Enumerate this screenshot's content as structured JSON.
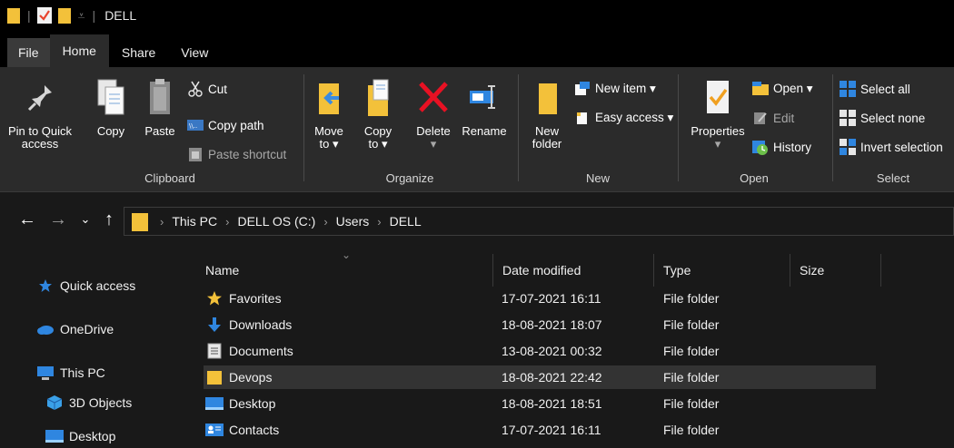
{
  "window": {
    "title": "DELL"
  },
  "colors": {
    "accent_folder": "#f3c13a",
    "selection": "#333333",
    "blue": "#1e90ff"
  },
  "tabs": [
    {
      "label": "File"
    },
    {
      "label": "Home"
    },
    {
      "label": "Share"
    },
    {
      "label": "View"
    }
  ],
  "ribbon": {
    "clipboard": {
      "group_label": "Clipboard",
      "pin_label_1": "Pin to Quick",
      "pin_label_2": "access",
      "copy_label": "Copy",
      "paste_label": "Paste",
      "cut_label": "Cut",
      "copy_path_label": "Copy path",
      "paste_shortcut_label": "Paste shortcut"
    },
    "organize": {
      "group_label": "Organize",
      "move_to_1": "Move",
      "move_to_2": "to ▾",
      "copy_to_1": "Copy",
      "copy_to_2": "to ▾",
      "delete_label": "Delete",
      "rename_label": "Rename"
    },
    "new": {
      "group_label": "New",
      "new_folder_1": "New",
      "new_folder_2": "folder",
      "new_item_label": "New item ▾",
      "easy_access_label": "Easy access ▾"
    },
    "open": {
      "group_label": "Open",
      "properties_label": "Properties",
      "open_label": "Open ▾",
      "edit_label": "Edit",
      "history_label": "History"
    },
    "select": {
      "group_label": "Select",
      "select_all_label": "Select all",
      "select_none_label": "Select none",
      "invert_selection_label": "Invert selection"
    }
  },
  "breadcrumb": [
    "This PC",
    "DELL OS (C:)",
    "Users",
    "DELL"
  ],
  "navpane": {
    "items": [
      {
        "label": "Quick access",
        "icon": "star-icon"
      },
      {
        "label": "OneDrive",
        "icon": "cloud-icon"
      },
      {
        "label": "This PC",
        "icon": "computer-icon"
      },
      {
        "label": "3D Objects",
        "icon": "cube-icon"
      },
      {
        "label": "Desktop",
        "icon": "desktop-icon"
      }
    ]
  },
  "filelist": {
    "columns": [
      "Name",
      "Date modified",
      "Type",
      "Size"
    ],
    "rows": [
      {
        "name": "Favorites",
        "date": "17-07-2021 16:11",
        "type": "File folder",
        "icon": "star-icon"
      },
      {
        "name": "Downloads",
        "date": "18-08-2021 18:07",
        "type": "File folder",
        "icon": "download-arrow-icon"
      },
      {
        "name": "Documents",
        "date": "13-08-2021 00:32",
        "type": "File folder",
        "icon": "document-icon"
      },
      {
        "name": "Devops",
        "date": "18-08-2021 22:42",
        "type": "File folder",
        "icon": "folder-icon",
        "selected": true
      },
      {
        "name": "Desktop",
        "date": "18-08-2021 18:51",
        "type": "File folder",
        "icon": "desktop-icon"
      },
      {
        "name": "Contacts",
        "date": "17-07-2021 16:11",
        "type": "File folder",
        "icon": "contact-card-icon"
      }
    ]
  }
}
